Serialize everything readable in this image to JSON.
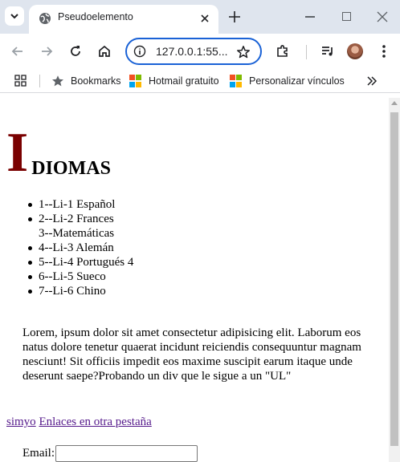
{
  "browser": {
    "tab": {
      "title": "Pseudoelemento"
    },
    "address_bar": {
      "url": "127.0.0.1:55..."
    },
    "bookmarks": [
      {
        "label": "Bookmarks",
        "icon": "star-icon"
      },
      {
        "label": "Hotmail gratuito",
        "icon": "microsoft-logo-icon"
      },
      {
        "label": "Personalizar vínculos",
        "icon": "microsoft-logo-icon"
      }
    ],
    "colors": {
      "accent": "#1a62d6",
      "tabstrip": "#dfe5ee"
    }
  },
  "page": {
    "heading": {
      "dropcap": "I",
      "rest": "DIOMAS",
      "dropcap_color": "#7a0000"
    },
    "languages": [
      {
        "text": "1--Li-1 Español",
        "bullet": true
      },
      {
        "text": "2--Li-2 Frances",
        "bullet": true
      },
      {
        "text": "3--Matemáticas",
        "bullet": false
      },
      {
        "text": "4--Li-3 Alemán",
        "bullet": true
      },
      {
        "text": "5--Li-4 Portugués 4",
        "bullet": true
      },
      {
        "text": "6--Li-5 Sueco",
        "bullet": true
      },
      {
        "text": "7--Li-6 Chino",
        "bullet": true
      }
    ],
    "paragraph": "Lorem, ipsum dolor sit amet consectetur adipisicing elit. Laborum eos natus dolore tenetur quaerat incidunt reiciendis consequuntur magnam nesciunt! Sit officiis impedit eos maxime suscipit earum itaque unde deserunt saepe?Probando un div que le sigue a un \"UL\"",
    "links": [
      {
        "label": "simyo"
      },
      {
        "label": "Enlaces en otra pestaña"
      }
    ],
    "form": {
      "email_label": "Email:",
      "email_value": ""
    }
  }
}
